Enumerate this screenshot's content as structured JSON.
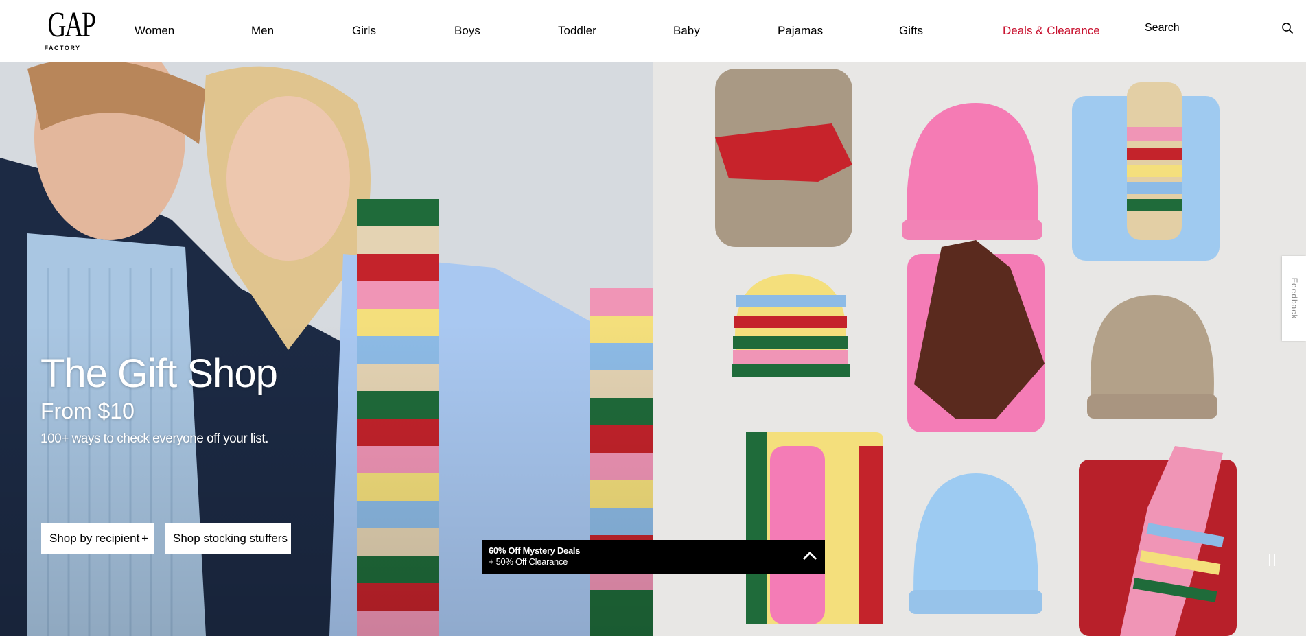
{
  "header": {
    "logo": {
      "wordmark": "GAP",
      "sub": "FACTORY"
    },
    "nav": [
      {
        "label": "Women"
      },
      {
        "label": "Men"
      },
      {
        "label": "Girls"
      },
      {
        "label": "Boys"
      },
      {
        "label": "Toddler"
      },
      {
        "label": "Baby"
      },
      {
        "label": "Pajamas"
      },
      {
        "label": "Gifts"
      },
      {
        "label": "Deals & Clearance"
      }
    ],
    "search": {
      "placeholder": "Search"
    }
  },
  "hero": {
    "title": "The Gift Shop",
    "subtitle": "From $10",
    "description": "100+ ways to check everyone off your list.",
    "cta_recipient": "Shop by recipient",
    "cta_recipient_icon": "+",
    "cta_stocking": "Shop stocking stuffers"
  },
  "promo": {
    "line1": "60% Off Mystery Deals",
    "line2": "+ 50% Off Clearance"
  },
  "feedback": {
    "label": "Feedback"
  },
  "colors": {
    "deals": "#c8102e",
    "promo_bg": "#000000"
  }
}
